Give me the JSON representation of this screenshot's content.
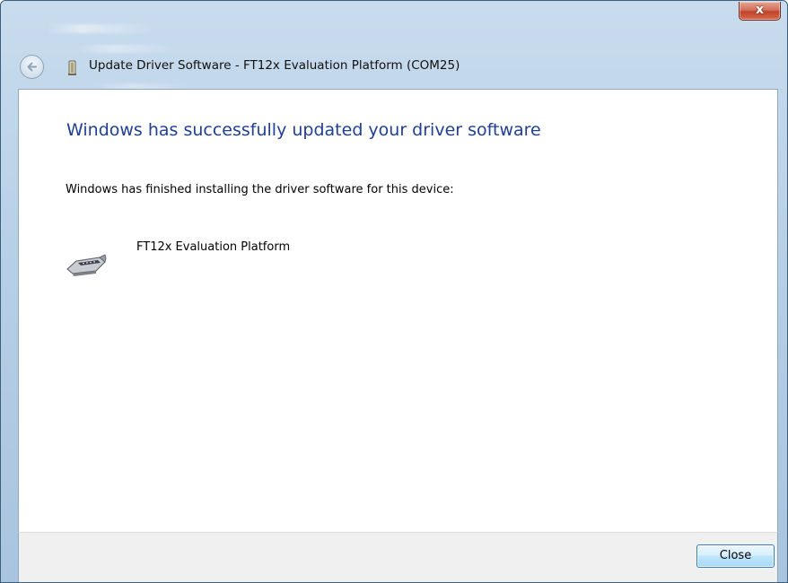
{
  "window": {
    "title": "Update Driver Software - FT12x Evaluation Platform (COM25)",
    "close_glyph": "x"
  },
  "content": {
    "heading": "Windows has successfully updated your driver software",
    "body": "Windows has finished installing the driver software for this device:",
    "device_name": "FT12x Evaluation Platform"
  },
  "footer": {
    "close_label": "Close"
  },
  "icons": {
    "back": "back-arrow-icon",
    "device_small": "serial-port-icon",
    "device_large": "serial-port-icon"
  },
  "colors": {
    "heading": "#1e3f95",
    "close_button_border": "#3c7fb1",
    "titlebar": "#b7cfe6"
  }
}
